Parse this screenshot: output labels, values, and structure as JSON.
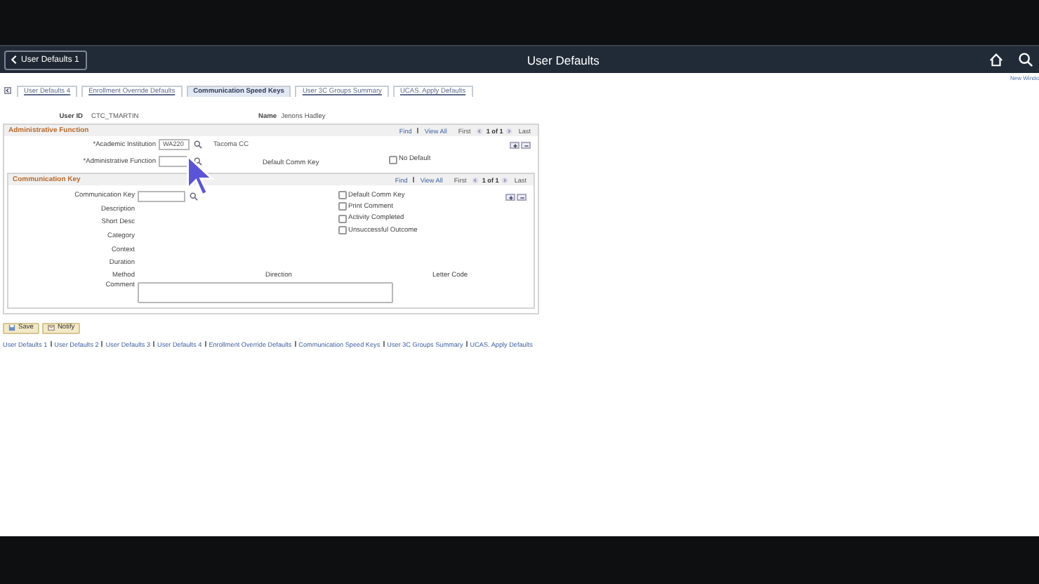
{
  "header": {
    "back_button": "User Defaults 1",
    "title": "User Defaults"
  },
  "new_window": "New Windo",
  "tabs": [
    {
      "label": "User Defaults 4",
      "selected": false
    },
    {
      "label": "Enrollment Override Defaults",
      "selected": false
    },
    {
      "label": "Communication Speed Keys",
      "selected": true
    },
    {
      "label": "User 3C Groups Summary",
      "selected": false
    },
    {
      "label": "UCAS. Apply Defaults",
      "selected": false
    }
  ],
  "user": {
    "id_label": "User ID",
    "id": "CTC_TMARTIN",
    "name_label": "Name",
    "name": "Jenons Hadley"
  },
  "admin": {
    "title": "Administrative Function",
    "find": "Find",
    "view_all": "View All",
    "first": "First",
    "count": "1 of 1",
    "last": "Last",
    "institution_label": "*Academic Institution",
    "institution": "WA220",
    "institution_name": "Tacoma CC",
    "function_label": "*Administrative Function",
    "default_key_label": "Default Comm Key",
    "no_default": {
      "label": "No Default",
      "checked": false
    }
  },
  "comm": {
    "title": "Communication Key",
    "find": "Find",
    "view_all": "View All",
    "first": "First",
    "count": "1 of 1",
    "last": "Last",
    "key_label": "Communication Key",
    "checks": [
      {
        "label": "Default Comm Key",
        "checked": false
      },
      {
        "label": "Print Comment",
        "checked": false
      },
      {
        "label": "Activity Completed",
        "checked": false
      },
      {
        "label": "Unsuccessful Outcome",
        "checked": false
      }
    ],
    "fields": [
      "Description",
      "Short Desc",
      "Category",
      "Context",
      "Duration"
    ],
    "method_label": "Method",
    "direction_label": "Direction",
    "letter_code_label": "Letter Code",
    "comment_label": "Comment"
  },
  "buttons": [
    "Save",
    "Notify"
  ],
  "links": [
    "User Defaults 1",
    "User Defaults 2",
    "User Defaults 3",
    "User Defaults 4",
    "Enrollment Override Defaults",
    "Communication Speed Keys",
    "User 3C Groups Summary",
    "UCAS. Apply Defaults"
  ]
}
